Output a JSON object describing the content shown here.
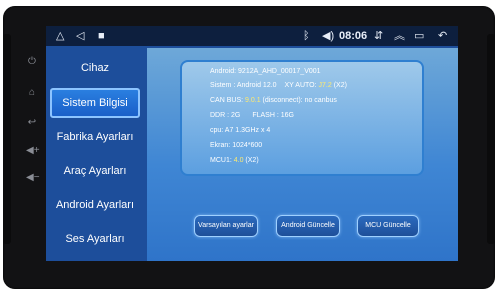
{
  "statusbar": {
    "time": "08:06",
    "left_icons": [
      "home-icon",
      "back-icon",
      "stop-icon"
    ],
    "right_icons": [
      "bluetooth-icon",
      "volume-icon",
      "usb-icon",
      "chevron-up-icon",
      "recent-apps-icon",
      "return-icon"
    ]
  },
  "bezel_icons": [
    "power-icon",
    "home-icon",
    "back-icon",
    "volume-up-icon",
    "volume-down-icon"
  ],
  "sidebar": {
    "items": [
      {
        "label": "Cihaz"
      },
      {
        "label": "Sistem Bilgisi",
        "selected": true
      },
      {
        "label": "Fabrika Ayarları"
      },
      {
        "label": "Araç Ayarları"
      },
      {
        "label": "Android Ayarları"
      },
      {
        "label": "Ses Ayarları"
      }
    ]
  },
  "info": {
    "android": {
      "label": "Android:",
      "value": "9212A_AHD_00017_V001"
    },
    "sistem": {
      "label": "Sistem :",
      "value": "Android 12.0",
      "xy_label": "XY AUTO:",
      "xy_value": "J7.2",
      "xy_suffix": "(X2)"
    },
    "canbus": {
      "label": "CAN BUS:",
      "value": "9.0.1",
      "status": "(disconnect):",
      "status_value": "no canbus"
    },
    "ddr": {
      "label": "DDR :",
      "value": "2G",
      "flash_label": "FLASH :",
      "flash_value": "16G"
    },
    "cpu": {
      "label": "cpu:",
      "value": "A7 1.3GHz x 4"
    },
    "ekran": {
      "label": "Ekran:",
      "value": "1024*600"
    },
    "mcu": {
      "label": "MCU1:",
      "value": "4.0",
      "suffix": "(X2)"
    }
  },
  "buttons": {
    "reset": "Varsayılan ayarlar",
    "android_update": "Android Güncelle",
    "mcu_update": "MCU Güncelle"
  }
}
